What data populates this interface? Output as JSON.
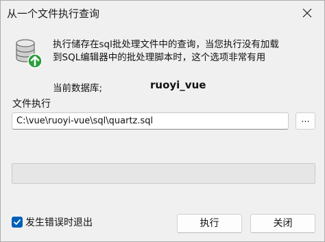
{
  "window": {
    "title": "从一个文件执行查询"
  },
  "description": {
    "line1": "执行储存在sql批处理文件中的查询，当您执行没有加载",
    "line2": "到SQL编辑器中的批处理脚本时，这个选项非常有用"
  },
  "database": {
    "label": "当前数据库;",
    "value": "ruoyi_vue"
  },
  "file": {
    "label": "文件执行",
    "path": "C:\\vue\\ruoyi-vue\\sql\\quartz.sql",
    "browse_label": "..."
  },
  "progress": {
    "percent": 0
  },
  "options": {
    "exit_on_error_label": "发生错误时退出",
    "exit_on_error_checked": true
  },
  "buttons": {
    "execute_label": "执行",
    "close_label": "关闭"
  },
  "colors": {
    "accent": "#005fb8",
    "window_bg": "#f0f0f0",
    "icon_arrow": "#2e9e3e"
  },
  "icons": {
    "close": "close-icon",
    "database": "database-icon",
    "checkmark": "checkmark-icon"
  }
}
